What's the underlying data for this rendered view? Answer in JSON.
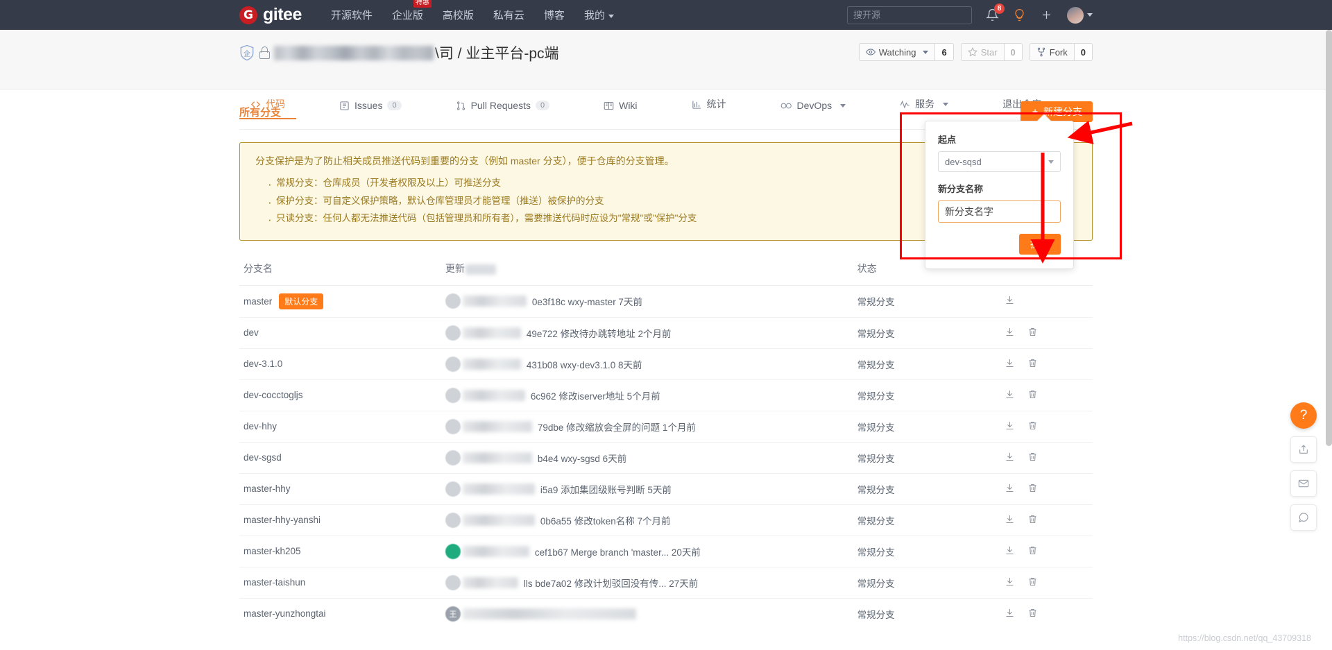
{
  "topnav": {
    "logo_mark": "G",
    "logo_text": "gitee",
    "links": [
      {
        "label": "开源软件",
        "badge": ""
      },
      {
        "label": "企业版",
        "badge": "特惠"
      },
      {
        "label": "高校版",
        "badge": ""
      },
      {
        "label": "私有云",
        "badge": ""
      },
      {
        "label": "博客",
        "badge": ""
      },
      {
        "label": "我的",
        "badge": "",
        "caret": true
      }
    ],
    "search_placeholder": "搜开源",
    "notification_count": "8",
    "icons": [
      "bell-icon",
      "lightbulb-icon",
      "plus-icon",
      "avatar"
    ]
  },
  "repo": {
    "owner_blurred": true,
    "title": "\\司 / 业主平台-pc端",
    "watching_label": "Watching",
    "watching_count": "6",
    "star_label": "Star",
    "star_count": "0",
    "fork_label": "Fork",
    "fork_count": "0",
    "tabs": [
      {
        "label": "代码",
        "icon": "code-icon",
        "count": "",
        "active": true
      },
      {
        "label": "Issues",
        "icon": "issue-icon",
        "count": "0",
        "active": false
      },
      {
        "label": "Pull Requests",
        "icon": "pr-icon",
        "count": "0",
        "active": false
      },
      {
        "label": "Wiki",
        "icon": "wiki-icon",
        "count": "",
        "active": false
      },
      {
        "label": "统计",
        "icon": "chart-icon",
        "count": "",
        "active": false
      },
      {
        "label": "DevOps",
        "icon": "infinity-icon",
        "count": "",
        "caret": true,
        "active": false
      },
      {
        "label": "服务",
        "icon": "pulse-icon",
        "count": "",
        "caret": true,
        "active": false
      },
      {
        "label": "退出仓库",
        "icon": "",
        "count": "",
        "active": false
      }
    ]
  },
  "main": {
    "section_title": "所有分支",
    "new_branch_button": "新建分支",
    "alert": {
      "lead": "分支保护是为了防止相关成员推送代码到重要的分支（例如 master 分支），便于仓库的分支管理。",
      "items": [
        "常规分支：仓库成员（开发者权限及以上）可推送分支",
        "保护分支：可自定义保护策略，默认仓库管理员才能管理（推送）被保护的分支",
        "只读分支：任何人都无法推送代码（包括管理员和所有者），需要推送代码时应设为\"常规\"或\"保护\"分支"
      ]
    },
    "table": {
      "headers": {
        "name": "分支名",
        "updated": "更新",
        "status": "状态",
        "actions": ""
      },
      "rows": [
        {
          "name": "master",
          "tag": "默认分支",
          "avatar": "gray",
          "blur_width": 92,
          "commit": "0e3f18c  wxy-master  7天前",
          "status": "常规分支",
          "actions": [
            "download-icon"
          ]
        },
        {
          "name": "dev",
          "tag": "",
          "avatar": "gray",
          "blur_width": 84,
          "commit": "49e722  修改待办跳转地址  2个月前",
          "status": "常规分支",
          "actions": [
            "download-icon",
            "trash-icon"
          ]
        },
        {
          "name": "dev-3.1.0",
          "tag": "",
          "avatar": "gray",
          "blur_width": 84,
          "commit": "431b08  wxy-dev3.1.0  8天前",
          "status": "常规分支",
          "actions": [
            "download-icon",
            "trash-icon"
          ]
        },
        {
          "name": "dev-cocctogljs",
          "tag": "",
          "avatar": "gray",
          "blur_width": 90,
          "commit": "6c962  修改iserver地址  5个月前",
          "status": "常规分支",
          "actions": [
            "download-icon",
            "trash-icon"
          ]
        },
        {
          "name": "dev-hhy",
          "tag": "",
          "avatar": "gray",
          "blur_width": 100,
          "commit": "79dbe  修改缩放会全屏的问题  1个月前",
          "status": "常规分支",
          "actions": [
            "download-icon",
            "trash-icon"
          ]
        },
        {
          "name": "dev-sgsd",
          "tag": "",
          "avatar": "gray",
          "blur_width": 100,
          "commit": "b4e4  wxy-sgsd  6天前",
          "status": "常规分支",
          "actions": [
            "download-icon",
            "trash-icon"
          ]
        },
        {
          "name": "master-hhy",
          "tag": "",
          "avatar": "gray",
          "blur_width": 104,
          "commit": "i5a9  添加集团级账号判断  5天前",
          "status": "常规分支",
          "actions": [
            "download-icon",
            "trash-icon"
          ]
        },
        {
          "name": "master-hhy-yanshi",
          "tag": "",
          "avatar": "gray",
          "blur_width": 104,
          "commit": "0b6a55  修改token名称  7个月前",
          "status": "常规分支",
          "actions": [
            "download-icon",
            "trash-icon"
          ]
        },
        {
          "name": "master-kh205",
          "tag": "",
          "avatar": "green",
          "blur_width": 96,
          "commit": "cef1b67  Merge branch 'master...  20天前",
          "status": "常规分支",
          "actions": [
            "download-icon",
            "trash-icon"
          ]
        },
        {
          "name": "master-taishun",
          "tag": "",
          "avatar": "gray",
          "blur_width": 80,
          "commit": "lls  bde7a02  修改计划驳回没有传...   27天前",
          "status": "常规分支",
          "actions": [
            "download-icon",
            "trash-icon"
          ]
        },
        {
          "name": "master-yunzhongtai",
          "tag": "",
          "avatar": "wang",
          "blur_width": 250,
          "commit": "",
          "status": "常规分支",
          "actions": [
            "download-icon",
            "trash-icon"
          ]
        }
      ]
    }
  },
  "new_branch_panel": {
    "start_point_label": "起点",
    "start_point_value": "dev-sqsd",
    "branch_name_label": "新分支名称",
    "branch_name_value": "新分支名字",
    "submit_label": "提交"
  },
  "floats": {
    "help": "?",
    "buttons": [
      "share-icon",
      "mail-icon",
      "comment-icon"
    ]
  },
  "watermark": "https://blog.csdn.net/qq_43709318",
  "colors": {
    "brand_orange": "#ff7a18",
    "nav_dark": "#353b49",
    "logo_red": "#c71d23",
    "alert_bg": "#fdf8e3",
    "alert_border": "#b9902e",
    "annotation_red": "#fe0000"
  }
}
